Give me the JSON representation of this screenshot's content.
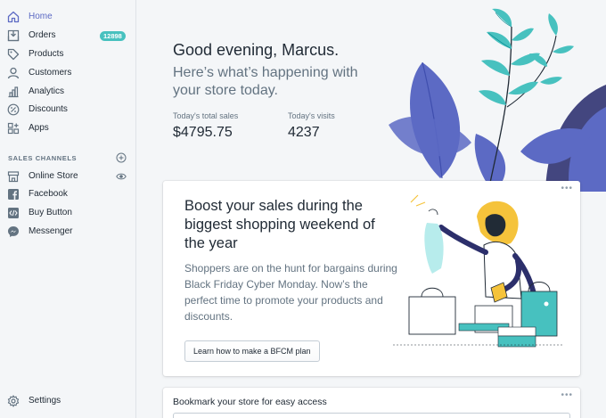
{
  "sidebar": {
    "items": [
      {
        "label": "Home",
        "icon": "home-icon",
        "active": true
      },
      {
        "label": "Orders",
        "icon": "orders-icon",
        "badge": "12898"
      },
      {
        "label": "Products",
        "icon": "tag-icon"
      },
      {
        "label": "Customers",
        "icon": "person-icon"
      },
      {
        "label": "Analytics",
        "icon": "bar-chart-icon"
      },
      {
        "label": "Discounts",
        "icon": "discount-icon"
      },
      {
        "label": "Apps",
        "icon": "apps-icon"
      }
    ],
    "sales_channels_title": "SALES CHANNELS",
    "channels": [
      {
        "label": "Online Store",
        "icon": "store-icon"
      },
      {
        "label": "Facebook",
        "icon": "facebook-icon"
      },
      {
        "label": "Buy Button",
        "icon": "code-icon"
      },
      {
        "label": "Messenger",
        "icon": "messenger-icon"
      }
    ],
    "settings_label": "Settings"
  },
  "header": {
    "greeting": "Good evening, Marcus.",
    "subtitle": "Here’s what’s happening with your store today.",
    "stats": [
      {
        "label": "Today's total sales",
        "value": "$4795.75"
      },
      {
        "label": "Today's visits",
        "value": "4237"
      }
    ]
  },
  "promo_card": {
    "menu": "•••",
    "title": "Boost your sales during the biggest shopping weekend of the year",
    "body": "Shoppers are on the hunt for bargains during Black Friday Cyber Monday. Now’s the perfect time to promote your products and discounts.",
    "button_label": "Learn how to make a BFCM plan"
  },
  "bookmark_card": {
    "menu": "•••",
    "title": "Bookmark your store for easy access"
  },
  "colors": {
    "accent": "#5c6ac4",
    "badge": "#47c1bf",
    "leaf_teal": "#47c1bf",
    "leaf_purple": "#5c6ac4"
  }
}
